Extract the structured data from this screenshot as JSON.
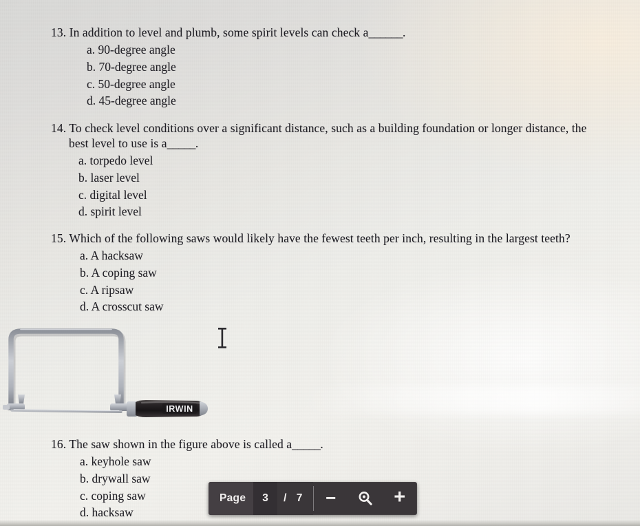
{
  "document": {
    "type": "scanned-quiz-page",
    "questions": [
      {
        "id": "q13",
        "number": "13.",
        "stem": "In addition to level and plumb, some spirit levels can check a",
        "blank": "______",
        "stem_tail": ".",
        "choices": [
          "a. 90-degree angle",
          "b. 70-degree angle",
          "c. 50-degree angle",
          "d. 45-degree angle"
        ]
      },
      {
        "id": "q14",
        "number": "14.",
        "stem": "To check level conditions over a significant distance, such as a building foundation or longer distance, the",
        "stem_continued": "best level to use is a",
        "blank": "_____",
        "stem_tail": ".",
        "choices": [
          "a. torpedo level",
          "b. laser level",
          "c. digital level",
          "d. spirit level"
        ]
      },
      {
        "id": "q15",
        "number": "15.",
        "stem": "Which of the following saws would likely have the fewest teeth per inch, resulting in the largest teeth?",
        "choices": [
          "a. A hacksaw",
          "b. A coping saw",
          "c. A ripsaw",
          "d. A crosscut saw"
        ]
      },
      {
        "id": "q16",
        "number": "16.",
        "stem": "The saw shown in the figure above is called a",
        "blank": "_____",
        "stem_tail": ".",
        "choices": [
          "a. keyhole saw",
          "b. drywall saw",
          "c. coping saw",
          "d. hacksaw"
        ]
      }
    ]
  },
  "figure": {
    "name": "coping-saw-photo",
    "brand_label": "IRWIN",
    "description": "Coping saw with U-shaped steel frame, thin blade and black handle"
  },
  "cursor": {
    "type": "text-ibeam"
  },
  "toolbar": {
    "page_label": "Page",
    "current_page": "3",
    "separator": "/",
    "total_pages": "7",
    "zoom_out_glyph": "−",
    "zoom_reset_icon": "magnifier-icon",
    "zoom_in_glyph": "+",
    "background_color": "#3a3639",
    "text_color": "#f2f0ef"
  }
}
